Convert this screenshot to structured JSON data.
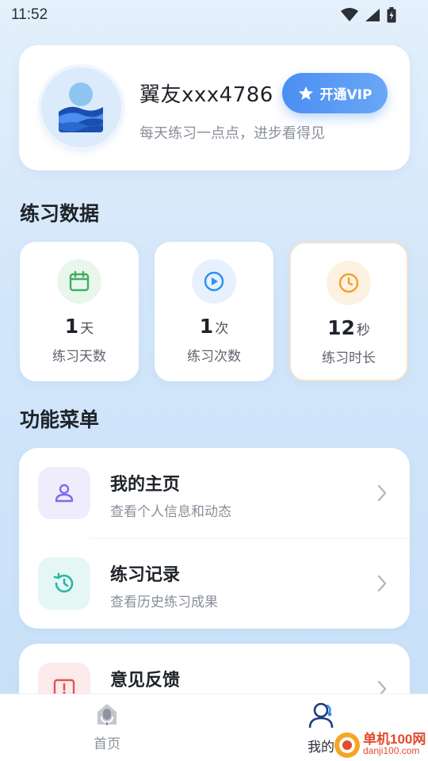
{
  "status_bar": {
    "time": "11:52"
  },
  "profile": {
    "username": "翼友xxx4786",
    "tagline": "每天练习一点点，进步看得见",
    "vip_label": "开通VIP"
  },
  "stats": {
    "title": "练习数据",
    "items": [
      {
        "value": "1",
        "unit": "天",
        "label": "练习天数",
        "icon": "calendar-icon",
        "color": "#3fae62"
      },
      {
        "value": "1",
        "unit": "次",
        "label": "练习次数",
        "icon": "play-icon",
        "color": "#2f8ff0"
      },
      {
        "value": "12",
        "unit": "秒",
        "label": "练习时长",
        "icon": "clock-icon",
        "color": "#f0a030"
      }
    ]
  },
  "menu": {
    "title": "功能菜单",
    "items": [
      {
        "title": "我的主页",
        "subtitle": "查看个人信息和动态",
        "icon": "user-icon"
      },
      {
        "title": "练习记录",
        "subtitle": "查看历史练习成果",
        "icon": "history-icon"
      },
      {
        "title": "意见反馈",
        "subtitle": "",
        "icon": "feedback-icon"
      }
    ]
  },
  "bottom_nav": {
    "items": [
      {
        "label": "首页",
        "icon": "home-mic-icon"
      },
      {
        "label": "我的",
        "icon": "profile-headset-icon"
      }
    ]
  },
  "watermark": {
    "line1": "单机100网",
    "line2": "danji100.com"
  },
  "colors": {
    "accent": "#4a8ef2",
    "vip_gradient_end": "#6aa7f5"
  }
}
